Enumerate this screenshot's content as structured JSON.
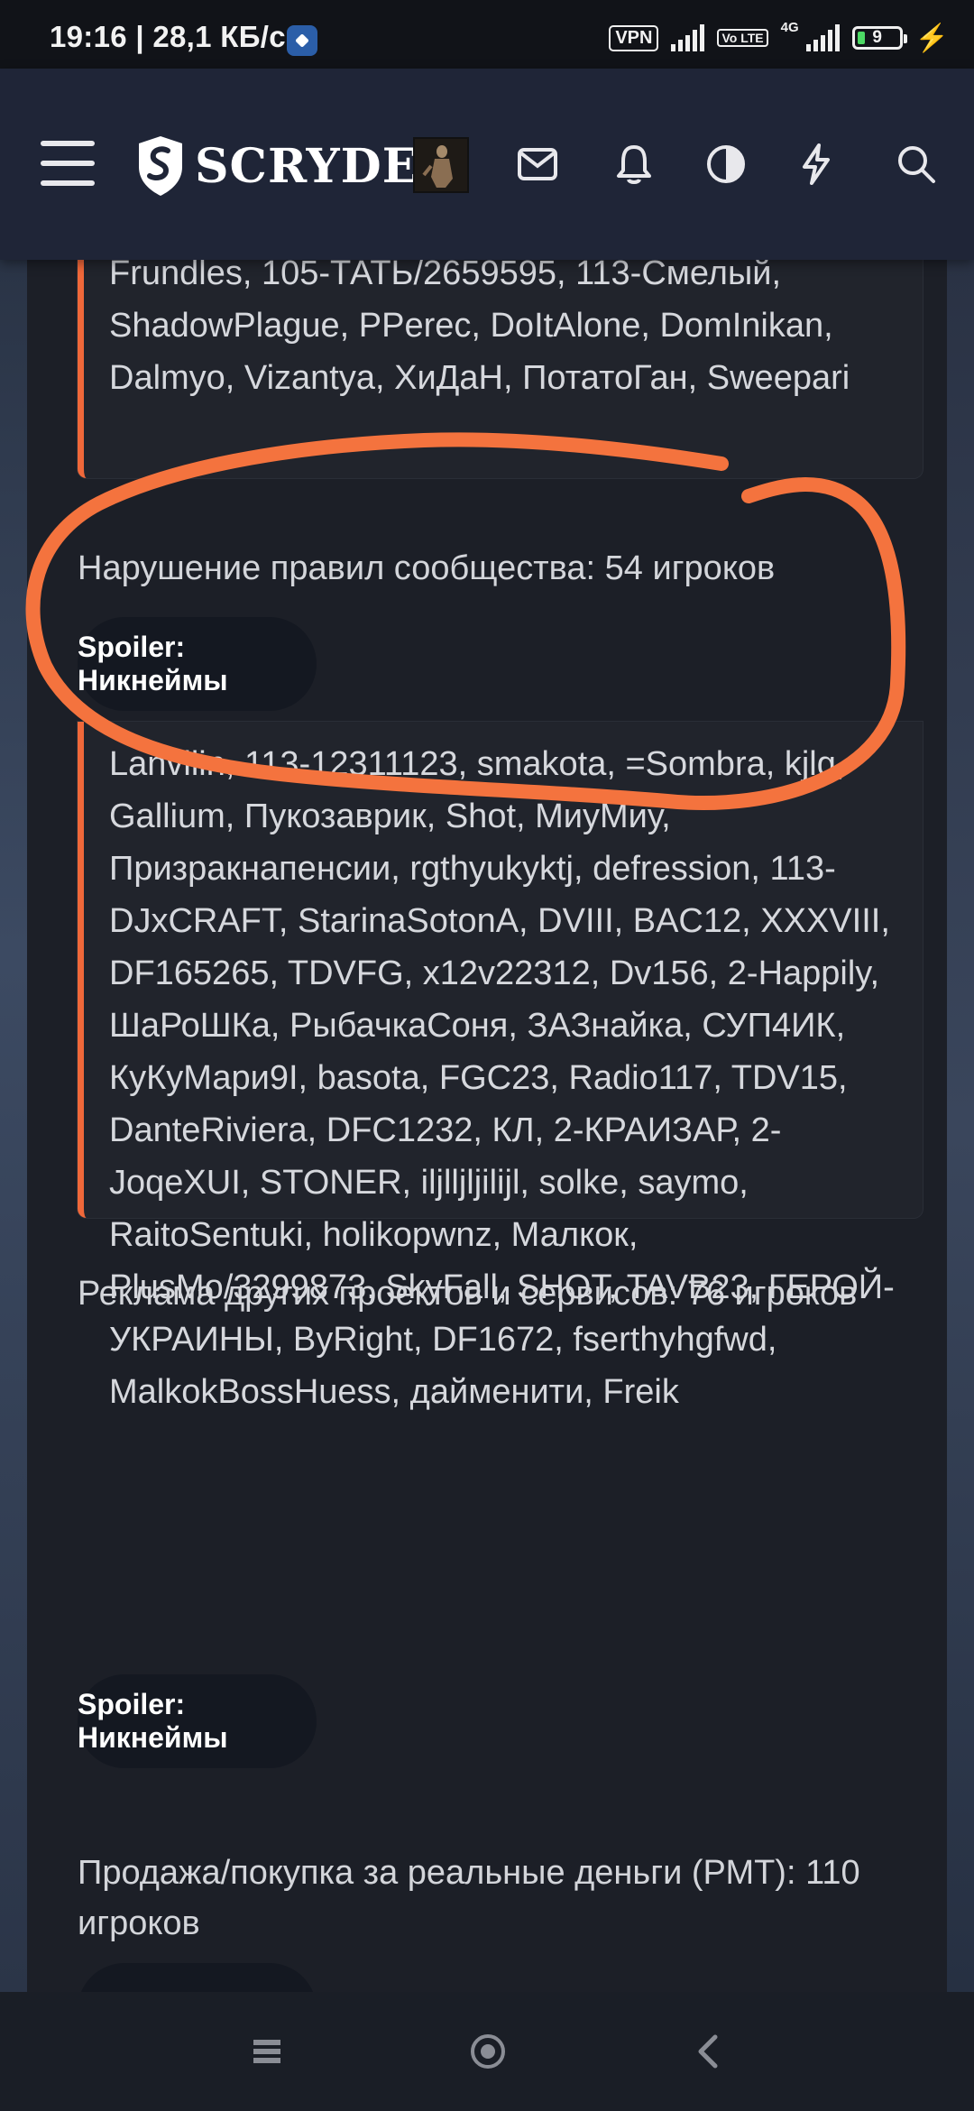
{
  "status_bar": {
    "time_speed": "19:16 | 28,1 КБ/с",
    "vpn": "VPN",
    "volte": "Vo LTE",
    "network": "4G",
    "battery": "9"
  },
  "header": {
    "logo_text": "SCRYDE",
    "icons": [
      "menu-icon",
      "mail-icon",
      "bell-icon",
      "contrast-icon",
      "bolt-icon",
      "search-icon"
    ]
  },
  "content": {
    "quote1_text": "Frundles, 105-ТАТЬ/2659595, 113-Смелый, ShadowPlague, PPerec, DoItAlone, DomInikan, Dalmyo, Vizantya, ХиДаН, ПотатоГан, Sweepari",
    "section1_title": "Нарушение правил сообщества: 54 игроков",
    "spoiler1": "Spoiler: Никнеймы",
    "quote2_text": "Lanvilin, 113-12311123, smakota, =Sombra, kjlg, Gallium, Пукозаврик, Shot, МиуМиу, Призракнапенсии, rgthyukyktj, defression, 113-DJxCRAFT, StarinaSotonA, DVIII, BAC12, XXXVIII, DF165265, TDVFG, x12v22312, Dv156, 2-Happily, ШаРоШКа, РыбачкаСоня, ЗАЗнайка, СУП4ИК, КуКуМари9I, basota, FGC23, Radio117, TDV15, DanteRiviera, DFC1232, КЛ, 2-КРАИЗАР, 2-JoqeXUI, STONER, iljlljljilijl, solke, saymo, RaitoSentuki, holikopwnz, Малкок, PlusMo/3299873, SkyFall, SHOT, TAVB23, ГЕРОЙ-УКРАИНЫ, ByRight, DF1672, fserthyhgfwd, MalkokBossHuess, дайменити, Freik",
    "section2_title": "Реклама других проектов и сервисов: 76 игроков",
    "spoiler2": "Spoiler: Никнеймы",
    "section3_title": "Продажа/покупка за реальные деньги (РМТ): 110 игроков"
  },
  "annotation_color": "#f4733e",
  "navbar": {
    "icons": [
      "recents-icon",
      "home-icon",
      "back-icon"
    ]
  }
}
